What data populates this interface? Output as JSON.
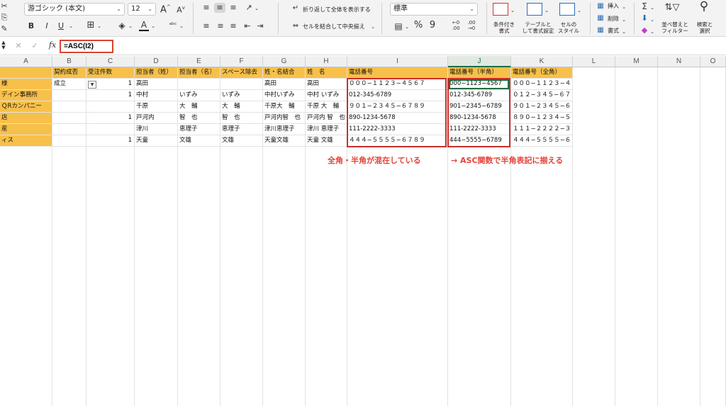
{
  "ribbon": {
    "font_name": "游ゴシック (本文)",
    "font_size": "12",
    "wrap_text": "折り返して全体を表示する",
    "merge_center": "セルを結合して中央揃え",
    "number_format": "標準",
    "bold": "B",
    "italic": "I",
    "underline": "U",
    "percent": "%",
    "comma": "9",
    "font_grow": "A",
    "font_shrink": "A",
    "cond_format": "条件付き\n書式",
    "table_format": "テーブルと\nして書式設定",
    "cell_style": "セルの\nスタイル",
    "insert": "挿入",
    "delete": "削除",
    "format": "書式",
    "sort_filter": "並べ替えと\nフィルター",
    "find_select": "検索と\n選択"
  },
  "formula_bar": {
    "fx": "fx",
    "formula": "=ASC(I2)"
  },
  "columns": [
    "A",
    "B",
    "C",
    "D",
    "E",
    "F",
    "G",
    "H",
    "I",
    "J",
    "K",
    "L",
    "M",
    "N",
    "O"
  ],
  "header_row": {
    "B": "契約成否",
    "C": "受注件数",
    "D": "担当者（姓）",
    "E": "担当者（名）",
    "F": "スペース除去",
    "G": "姓・名結合",
    "H": "姓　名",
    "I": "電話番号",
    "J": "電話番号（半角）",
    "K": "電話番号（全角）"
  },
  "rows": [
    {
      "A": "様",
      "B": "成立",
      "C": "1",
      "D": "高田",
      "E": "",
      "F": "",
      "G": "高田",
      "H": "高田",
      "I": "０００−１１２３−４５６７",
      "J": "000−1123−4567",
      "K": "０００−１１２３−４５６７"
    },
    {
      "A": "デイン事務所",
      "B": "",
      "C": "1",
      "D": "中村",
      "E": "いずみ",
      "F": "いずみ",
      "G": "中村いずみ",
      "H": "中村 いずみ",
      "I": "012-345-6789",
      "J": "012-345-6789",
      "K": "０１２−３４５−６７８９"
    },
    {
      "A": "ＱRカンパニー",
      "B": "",
      "C": "",
      "D": "千原",
      "E": "大　輔",
      "F": "大　輔",
      "G": "千原大　輔",
      "H": "千原 大　輔",
      "I": "９０１−２３４５−６７８９",
      "J": "901−2345−6789",
      "K": "９０１−２３４５−６７８９"
    },
    {
      "A": "店",
      "B": "",
      "C": "1",
      "D": "戸河内",
      "E": "智　也",
      "F": "智　也",
      "G": "戸河内智　也",
      "H": "戸河内 智　也",
      "I": "890-1234-5678",
      "J": "890-1234-5678",
      "K": "８９０−１２３４−５６７８"
    },
    {
      "A": "産",
      "B": "",
      "C": "",
      "D": "津川",
      "E": "恵理子",
      "F": "恵理子",
      "G": "津川恵理子",
      "H": "津川 恵理子",
      "I": "111-2222-3333",
      "J": "111-2222-3333",
      "K": "１１１−２２２２−３３３３"
    },
    {
      "A": "ィス",
      "B": "",
      "C": "1",
      "D": "天童",
      "E": "文雄",
      "F": "文雄",
      "G": "天童文雄",
      "H": "天童 文雄",
      "I": "４４４−５５５５−６７８９",
      "J": "444−5555−6789",
      "K": "４４４−５５５５−６７８９"
    }
  ],
  "annotations": {
    "left": "全角・半角が混在している",
    "right": "→ ASC関数で半角表記に揃える"
  },
  "colors": {
    "header_fill": "#f7c04a",
    "highlight_red": "#c9302c",
    "annotation_red": "#e3433a",
    "excel_green": "#1d6f42"
  }
}
